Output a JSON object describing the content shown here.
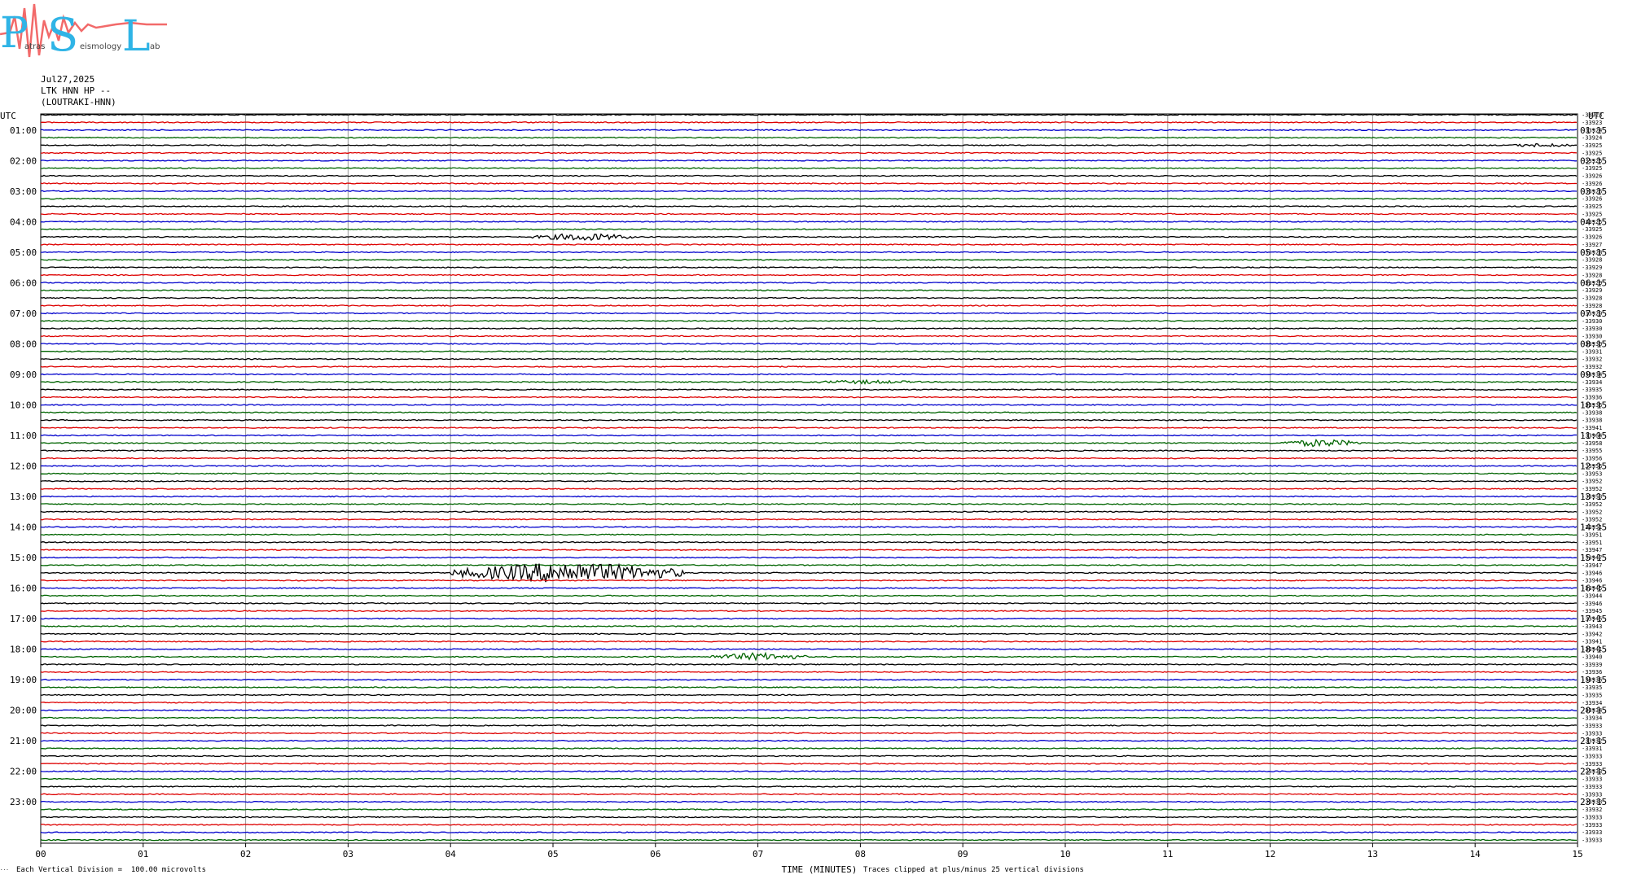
{
  "logo": {
    "letters": [
      "P",
      "S",
      "L"
    ],
    "small_text": [
      "atras",
      "eismology",
      "ab"
    ],
    "colors": {
      "letters": "#2fb4e6",
      "wave": "#f26a6a"
    }
  },
  "header": {
    "date": "Jul27,2025",
    "station": "LTK HNN HP --",
    "location": "(LOUTRAKI-HNN)"
  },
  "chart_data": {
    "type": "line",
    "title": "",
    "xlabel": "TIME (MINUTES)",
    "x_ticks": [
      "00",
      "01",
      "02",
      "03",
      "04",
      "05",
      "06",
      "07",
      "08",
      "09",
      "10",
      "11",
      "12",
      "13",
      "14",
      "15"
    ],
    "xlim": [
      0,
      15
    ],
    "grid": true,
    "utc_label_left": "UTC",
    "utc_label_right": "UTC",
    "hour_labels_left": [
      "01:00",
      "02:00",
      "03:00",
      "04:00",
      "05:00",
      "06:00",
      "07:00",
      "08:00",
      "09:00",
      "10:00",
      "11:00",
      "12:00",
      "13:00",
      "14:00",
      "15:00",
      "16:00",
      "17:00",
      "18:00",
      "19:00",
      "20:00",
      "21:00",
      "22:00",
      "23:00"
    ],
    "hour_labels_right": [
      "01:15",
      "02:15",
      "03:15",
      "04:15",
      "05:15",
      "06:15",
      "07:15",
      "08:15",
      "09:15",
      "10:15",
      "11:15",
      "12:15",
      "13:15",
      "14:15",
      "15:15",
      "16:15",
      "17:15",
      "18:15",
      "19:15",
      "20:15",
      "21:15",
      "22:15",
      "23:15"
    ],
    "trace_colors": [
      "#000000",
      "#dd0000",
      "#0000cc",
      "#006400"
    ],
    "trace_count": 96,
    "trace_offsets": [
      -33923,
      -33923,
      -33924,
      -33924,
      -33925,
      -33925,
      -33925,
      -33925,
      -33926,
      -33926,
      -33926,
      -33926,
      -33925,
      -33925,
      -33925,
      -33925,
      -33926,
      -33927,
      -33928,
      -33928,
      -33929,
      -33928,
      -33929,
      -33929,
      -33928,
      -33928,
      -33929,
      -33930,
      -33930,
      -33930,
      -33930,
      -33931,
      -33932,
      -33932,
      -33934,
      -33934,
      -33935,
      -33936,
      -33936,
      -33938,
      -33938,
      -33941,
      -33964,
      -33958,
      -33955,
      -33956,
      -33956,
      -33953,
      -33952,
      -33952,
      -33953,
      -33952,
      -33952,
      -33952,
      -33951,
      -33951,
      -33951,
      -33947,
      -33947,
      -33947,
      -33946,
      -33946,
      -33945,
      -33944,
      -33946,
      -33945,
      -33945,
      -33943,
      -33942,
      -33941,
      -33941,
      -33940,
      -33939,
      -33936,
      -33936,
      -33935,
      -33935,
      -33934,
      -33934,
      -33934,
      -33933,
      -33933,
      -33932,
      -33931,
      -33933,
      -33933,
      -33933,
      -33933,
      -33933,
      -33933,
      -33933,
      -33932,
      -33933,
      -33933,
      -33933,
      -33933
    ],
    "events": [
      {
        "trace": 16,
        "start_min": 5.1,
        "end_min": 5.5,
        "amplitude": "small"
      },
      {
        "trace": 43,
        "start_min": 12.4,
        "end_min": 12.6,
        "amplitude": "small"
      },
      {
        "trace": 60,
        "start_min": 4.3,
        "end_min": 6.0,
        "amplitude": "large"
      },
      {
        "trace": 71,
        "start_min": 6.8,
        "end_min": 7.2,
        "amplitude": "small"
      },
      {
        "trace": 35,
        "start_min": 7.8,
        "end_min": 8.3,
        "amplitude": "tiny"
      },
      {
        "trace": 4,
        "start_min": 14.6,
        "end_min": 14.7,
        "amplitude": "tiny"
      }
    ]
  },
  "footer": {
    "scale_note": "Each Vertical Division =  100.00 microvolts",
    "clip_note": "Traces clipped at plus/minus 25 vertical divisions",
    "corner_mark": "..."
  }
}
